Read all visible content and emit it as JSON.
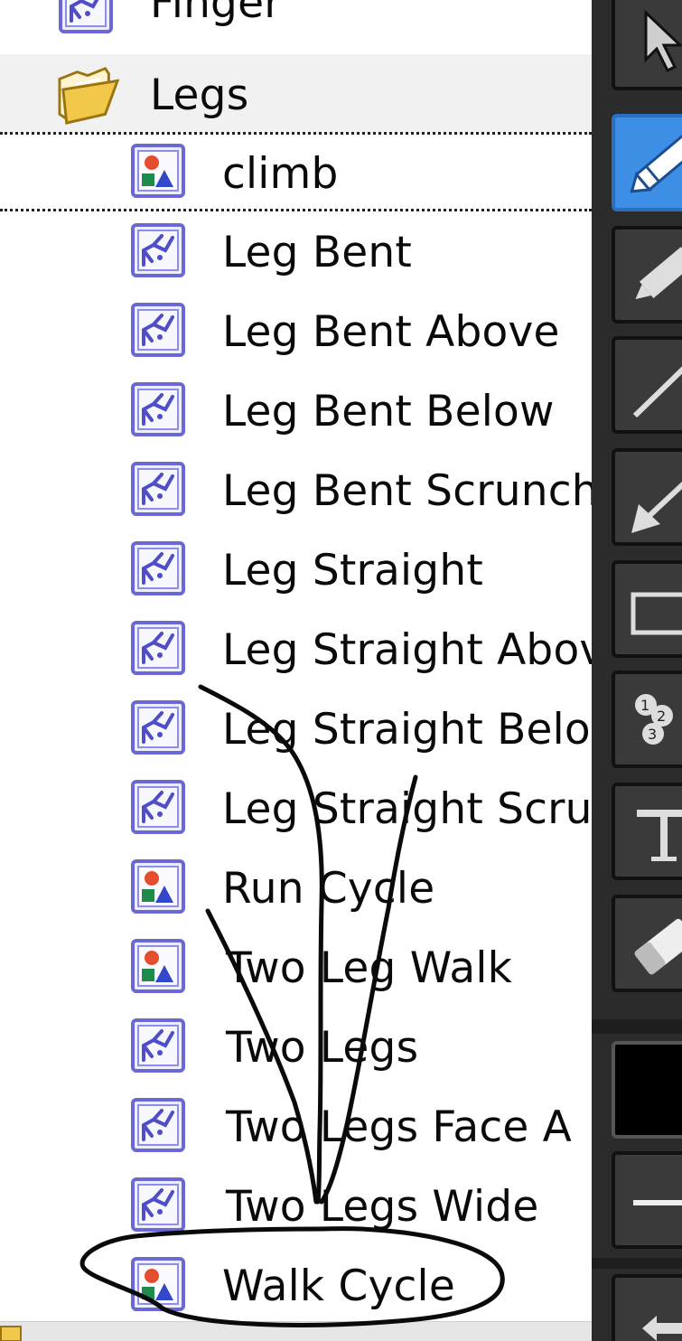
{
  "tree": {
    "items": [
      {
        "label": "Finger",
        "icon": "pose-icon",
        "kind": "file"
      },
      {
        "label": "Legs",
        "icon": "folder-open-icon",
        "kind": "folder"
      },
      {
        "label": "climb",
        "icon": "animation-icon",
        "kind": "file",
        "focused": true
      },
      {
        "label": "Leg Bent",
        "icon": "pose-icon",
        "kind": "file"
      },
      {
        "label": "Leg Bent Above",
        "icon": "pose-icon",
        "kind": "file"
      },
      {
        "label": "Leg Bent Below",
        "icon": "pose-icon",
        "kind": "file"
      },
      {
        "label": "Leg Bent Scrunch",
        "icon": "pose-icon",
        "kind": "file"
      },
      {
        "label": "Leg Straight",
        "icon": "pose-icon",
        "kind": "file"
      },
      {
        "label": "Leg Straight Above",
        "icon": "pose-icon",
        "kind": "file"
      },
      {
        "label": "Leg Straight Below",
        "icon": "pose-icon",
        "kind": "file"
      },
      {
        "label": "Leg Straight Scrunch",
        "icon": "pose-icon",
        "kind": "file"
      },
      {
        "label": "Run Cycle",
        "icon": "animation-icon",
        "kind": "file"
      },
      {
        "label": "Two Leg Walk",
        "icon": "animation-icon",
        "kind": "file"
      },
      {
        "label": "Two Legs",
        "icon": "pose-icon",
        "kind": "file"
      },
      {
        "label": "Two Legs Face A",
        "icon": "pose-icon",
        "kind": "file"
      },
      {
        "label": "Two Legs Wide",
        "icon": "pose-icon",
        "kind": "file"
      },
      {
        "label": "Walk Cycle",
        "icon": "animation-icon",
        "kind": "file"
      }
    ]
  },
  "toolbar": {
    "tools": [
      "select-arrow-icon",
      "pencil-icon",
      "highlighter-icon",
      "line-icon",
      "arrow-icon",
      "rectangle-icon",
      "numbering-icon",
      "text-icon",
      "eraser-icon",
      "color-swatch-icon",
      "line-width-icon",
      "undo-icon"
    ],
    "active_tool": "pencil-icon"
  },
  "colors": {
    "tree_background": "#ffffff",
    "folder_row_background": "#f1f1f1",
    "toolbar_background": "#2b2b2b",
    "active_tool_background": "#3d8fe6",
    "annotation_ink": "#0a0a0a"
  }
}
